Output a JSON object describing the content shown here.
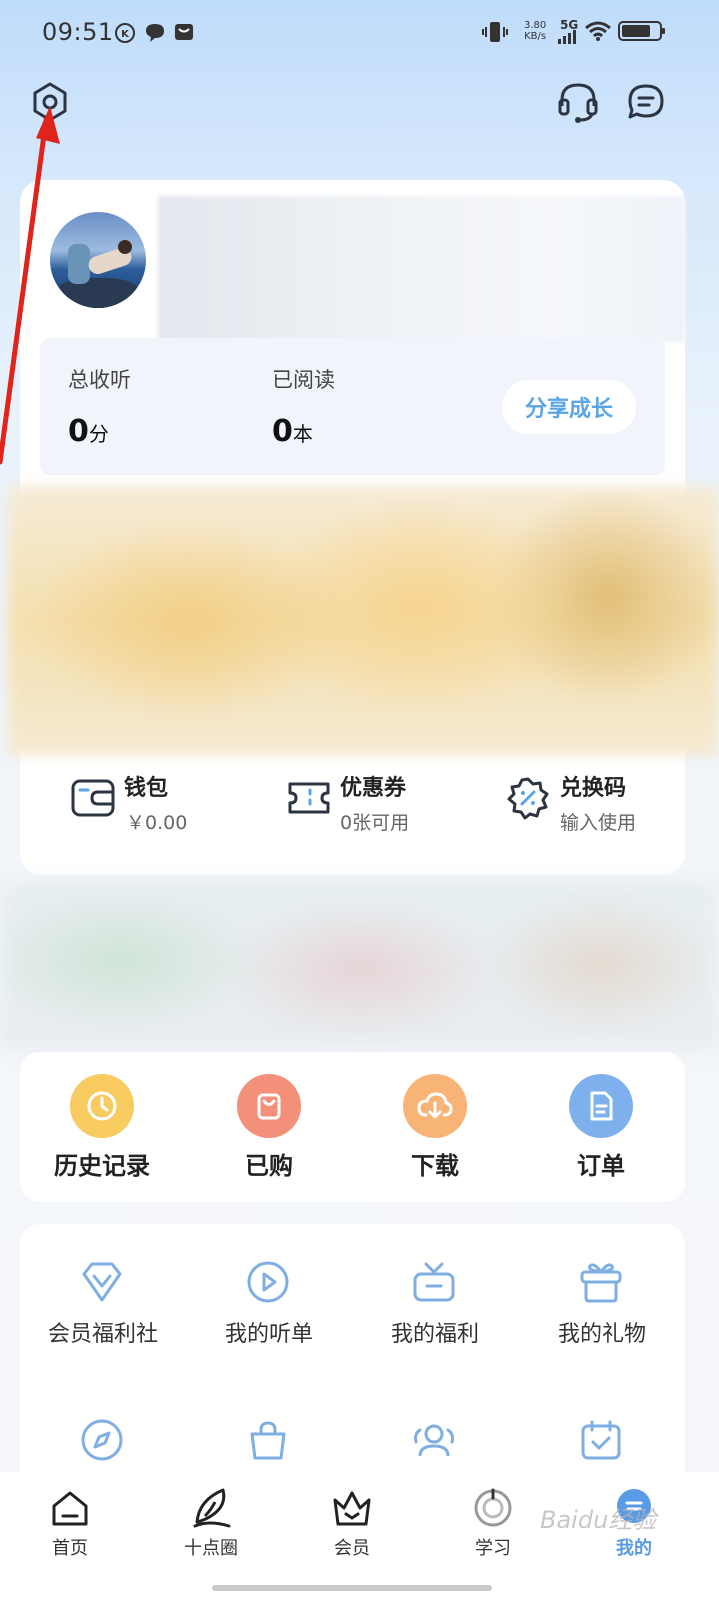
{
  "status_bar": {
    "time": "09:51",
    "net_speed_value": "3.80",
    "net_speed_unit": "KB/s",
    "signal": "5G"
  },
  "header": {
    "settings_icon": "settings-hexagon-icon",
    "service_icon": "headset-icon",
    "message_icon": "chat-bubble-icon"
  },
  "profile": {
    "listen_label": "总收听",
    "listen_value": "0",
    "listen_unit": "分",
    "read_label": "已阅读",
    "read_value": "0",
    "read_unit": "本",
    "share_label": "分享成长"
  },
  "wallet_row": [
    {
      "title": "钱包",
      "sub": "￥0.00",
      "icon": "wallet-icon"
    },
    {
      "title": "优惠券",
      "sub": "0张可用",
      "icon": "coupon-icon"
    },
    {
      "title": "兑换码",
      "sub": "输入使用",
      "icon": "percent-badge-icon"
    }
  ],
  "quick_actions": [
    {
      "label": "历史记录",
      "icon": "clock-icon",
      "color": "#f8cb61"
    },
    {
      "label": "已购",
      "icon": "bag-icon",
      "color": "#f3907a"
    },
    {
      "label": "下载",
      "icon": "download-cloud-icon",
      "color": "#f7b476"
    },
    {
      "label": "订单",
      "icon": "document-icon",
      "color": "#7fb0ee"
    }
  ],
  "menu_items": [
    {
      "label": "会员福利社",
      "icon": "diamond-icon"
    },
    {
      "label": "我的听单",
      "icon": "play-circle-icon"
    },
    {
      "label": "我的福利",
      "icon": "gift-box-icon"
    },
    {
      "label": "我的礼物",
      "icon": "present-icon"
    }
  ],
  "menu_row2_icons": [
    "compass-icon",
    "shopping-bag-icon",
    "group-icon",
    "calendar-check-icon"
  ],
  "tabs": [
    {
      "label": "首页",
      "icon": "home-icon"
    },
    {
      "label": "十点圈",
      "icon": "feather-icon"
    },
    {
      "label": "会员",
      "icon": "crown-icon"
    },
    {
      "label": "学习",
      "icon": "learn-circle-icon"
    },
    {
      "label": "我的",
      "icon": "profile-active-icon",
      "active": true
    }
  ],
  "colors": {
    "accent": "#5aa5e6",
    "icon_blue": "#7eaee2",
    "active_tab": "#5a9be6"
  },
  "watermark": "Baidu经验"
}
